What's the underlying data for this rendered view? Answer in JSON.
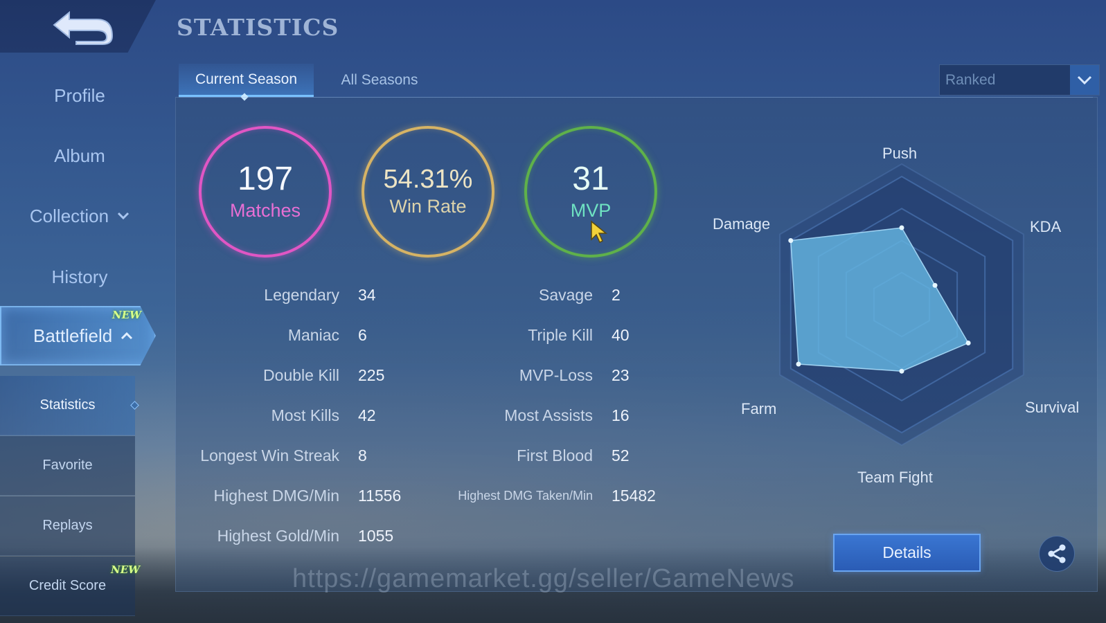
{
  "header": {
    "title": "STATISTICS",
    "back_icon": "back-arrow-icon"
  },
  "sidebar": {
    "profile": "Profile",
    "album": "Album",
    "collection": "Collection",
    "history": "History",
    "battlefield": "Battlefield",
    "battlefield_badge": "NEW",
    "sub_items": {
      "statistics": "Statistics",
      "favorite": "Favorite",
      "replays": "Replays",
      "credit_score": "Credit Score",
      "credit_score_badge": "NEW"
    }
  },
  "tabs": {
    "current": "Current Season",
    "all": "All Seasons"
  },
  "mode_select": {
    "value": "Ranked"
  },
  "summary": {
    "matches": {
      "value": "197",
      "label": "Matches"
    },
    "win_rate": {
      "value": "54.31%",
      "label": "Win Rate"
    },
    "mvp": {
      "value": "31",
      "label": "MVP"
    }
  },
  "stats_left": [
    {
      "label": "Legendary",
      "value": "34"
    },
    {
      "label": "Maniac",
      "value": "6"
    },
    {
      "label": "Double Kill",
      "value": "225"
    },
    {
      "label": "Most Kills",
      "value": "42"
    },
    {
      "label": "Longest Win Streak",
      "value": "8"
    },
    {
      "label": "Highest DMG/Min",
      "value": "11556"
    },
    {
      "label": "Highest Gold/Min",
      "value": "1055"
    }
  ],
  "stats_right": [
    {
      "label": "Savage",
      "value": "2"
    },
    {
      "label": "Triple Kill",
      "value": "40"
    },
    {
      "label": "MVP-Loss",
      "value": "23"
    },
    {
      "label": "Most Assists",
      "value": "16"
    },
    {
      "label": "First Blood",
      "value": "52"
    },
    {
      "label": "Highest DMG Taken/Min",
      "value": "15482"
    }
  ],
  "radar": {
    "axes": [
      "Push",
      "KDA",
      "Survival",
      "Team Fight",
      "Farm",
      "Damage"
    ],
    "values": [
      0.6,
      0.3,
      0.6,
      0.52,
      0.93,
      1.0
    ]
  },
  "buttons": {
    "details": "Details",
    "share_icon": "share-icon"
  },
  "watermark": "https://gamemarket.gg/seller/GameNews",
  "colors": {
    "matches": "#e056c4",
    "win_rate": "#d6b365",
    "mvp": "#5fb14a",
    "accent": "#3a76d2"
  }
}
